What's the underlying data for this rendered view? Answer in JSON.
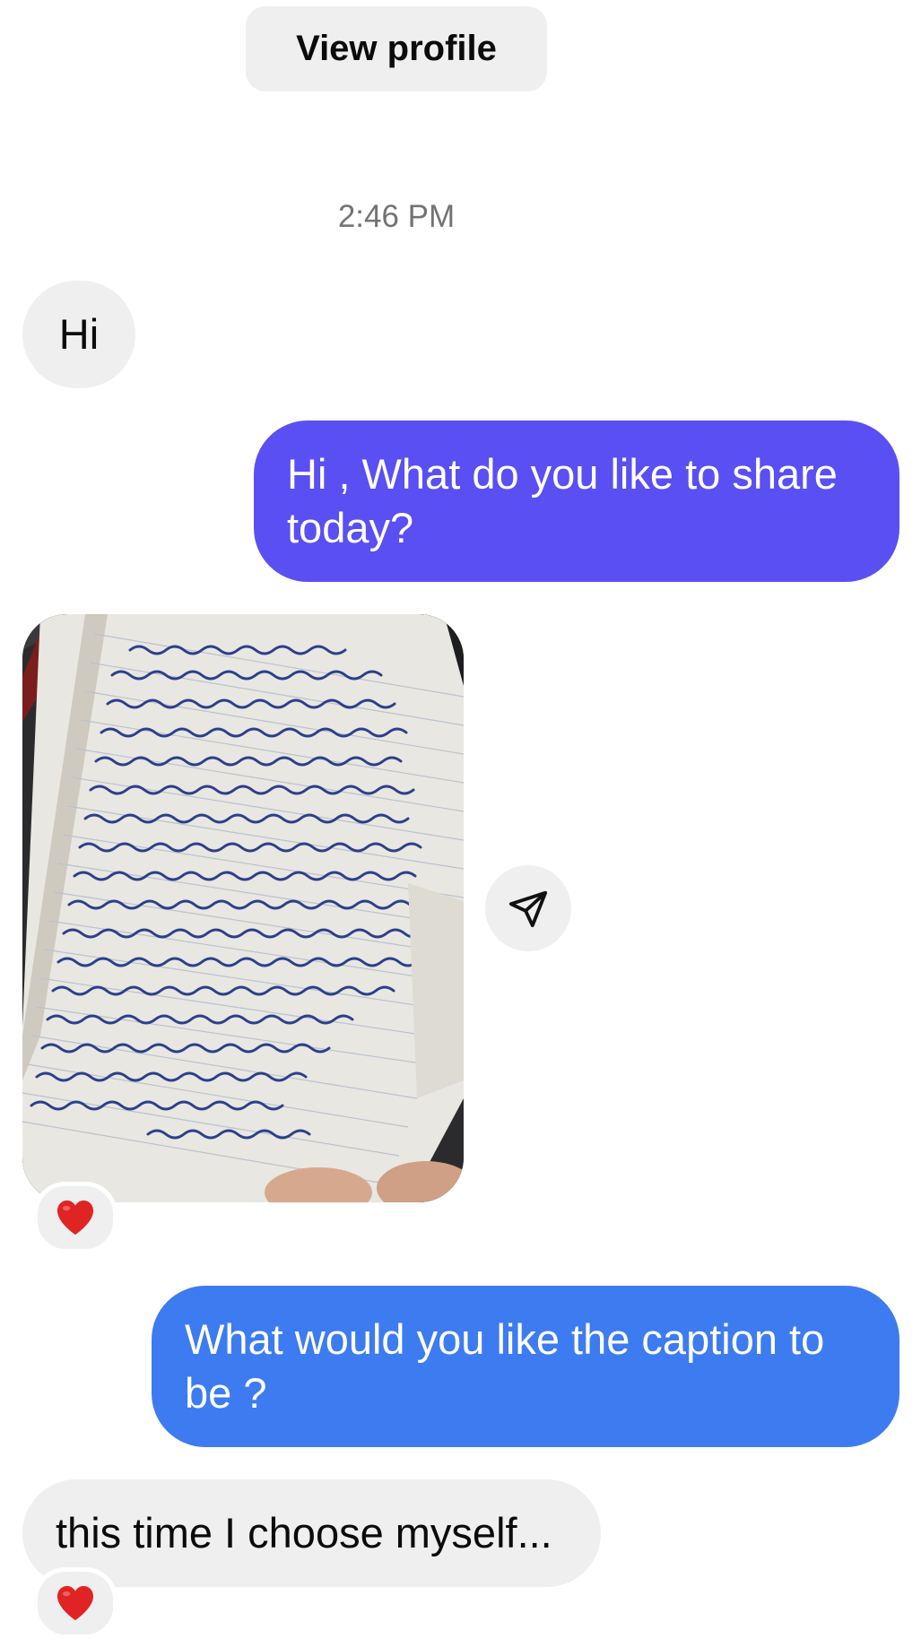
{
  "header": {
    "view_profile_label": "View profile"
  },
  "thread": {
    "timestamp": "2:46 PM",
    "messages": [
      {
        "sender": "them",
        "text": "Hi"
      },
      {
        "sender": "me",
        "text": "Hi , What do you like to share today?"
      },
      {
        "sender": "them",
        "type": "photo",
        "photo_subject": "handwritten note in a notebook",
        "reaction": "❤️"
      },
      {
        "sender": "me",
        "text": "What would you like the caption to be ?"
      },
      {
        "sender": "them",
        "text": "this time I choose myself...",
        "reaction": "❤️"
      }
    ]
  },
  "icons": {
    "share": "paper-plane-icon",
    "reaction": "red-heart-icon"
  },
  "colors": {
    "incoming_bubble": "#efefef",
    "outgoing_purple": "#5a4ff2",
    "outgoing_blue": "#3d7bf0",
    "timestamp_text": "#737373",
    "heart": "#e02424"
  }
}
